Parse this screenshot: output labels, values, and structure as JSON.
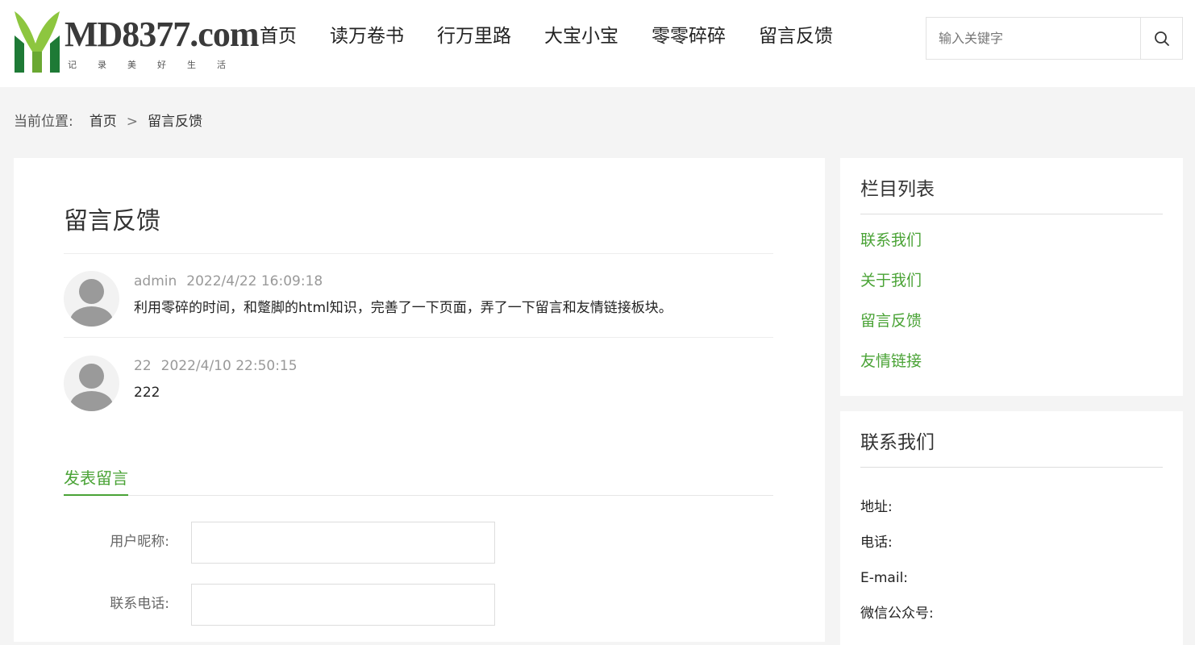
{
  "header": {
    "logo": {
      "text": "MD8377.com",
      "subtitle": "记录美好生活",
      "colors": {
        "leaf_light": "#8dc63f",
        "leaf_dark": "#1e7a36"
      }
    },
    "nav": [
      "首页",
      "读万卷书",
      "行万里路",
      "大宝小宝",
      "零零碎碎",
      "留言反馈"
    ],
    "search": {
      "placeholder": "输入关键字",
      "icon": "search-icon"
    }
  },
  "breadcrumb": {
    "label": "当前位置:",
    "items": [
      "首页",
      "留言反馈"
    ],
    "separator": ">"
  },
  "main": {
    "title": "留言反馈",
    "comments": [
      {
        "author": "admin",
        "time": "2022/4/22 16:09:18",
        "text": "利用零碎的时间，和蹩脚的html知识，完善了一下页面，弄了一下留言和友情链接板块。"
      },
      {
        "author": "22",
        "time": "2022/4/10 22:50:15",
        "text": "222"
      }
    ],
    "form": {
      "tab": "发表留言",
      "fields": [
        {
          "label": "用户昵称:",
          "value": ""
        },
        {
          "label": "联系电话:",
          "value": ""
        }
      ]
    }
  },
  "sidebar": {
    "categories": {
      "title": "栏目列表",
      "items": [
        "联系我们",
        "关于我们",
        "留言反馈",
        "友情链接"
      ]
    },
    "contact": {
      "title": "联系我们",
      "rows": [
        "地址:",
        "电话:",
        "E-mail:",
        "微信公众号:"
      ]
    }
  },
  "colors": {
    "accent": "#4aa336",
    "page_bg": "#f4f4f4",
    "card_bg": "#ffffff"
  }
}
